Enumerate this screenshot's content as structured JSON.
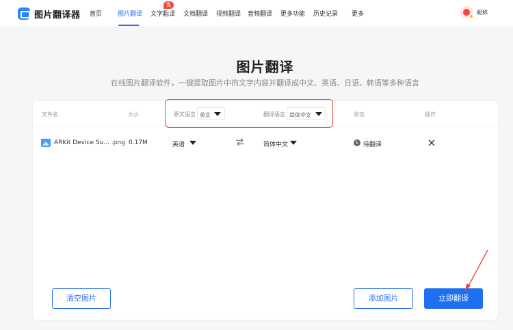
{
  "header": {
    "logo_text": "图片翻译器",
    "nav": [
      {
        "label": "首页"
      },
      {
        "label": "图片翻译"
      },
      {
        "label": "文字翻译"
      },
      {
        "label": "文档翻译"
      },
      {
        "label": "视频翻译"
      },
      {
        "label": "音频翻译"
      },
      {
        "label": "更多功能"
      },
      {
        "label": "历史记录"
      },
      {
        "label": "更多"
      }
    ],
    "free_badge": "免费",
    "user_nickname": "昵称",
    "active_nav": "图片翻译"
  },
  "page": {
    "title": "图片翻译",
    "subtitle": "在线图片翻译软件，一键提取图片中的文字内容并翻译成中文、英语、日语、韩语等多种语言"
  },
  "table": {
    "headers": {
      "file_name": "文件名",
      "size": "大小",
      "source_lang": "原文语言",
      "target_lang": "翻译语言",
      "status": "状态",
      "action": "操作"
    },
    "header_source_value": "英文",
    "header_target_value": "简体中文",
    "rows": [
      {
        "file_name": "ARKit Device Su... .png",
        "size": "0.17M",
        "source_lang": "英语",
        "target_lang": "简体中文",
        "status": "待翻译"
      }
    ]
  },
  "buttons": {
    "clear": "清空图片",
    "add": "添加图片",
    "translate": "立即翻译"
  },
  "colors": {
    "primary": "#1f6ff2",
    "highlight_box": "#e8473e",
    "badge": "#f5483b"
  }
}
